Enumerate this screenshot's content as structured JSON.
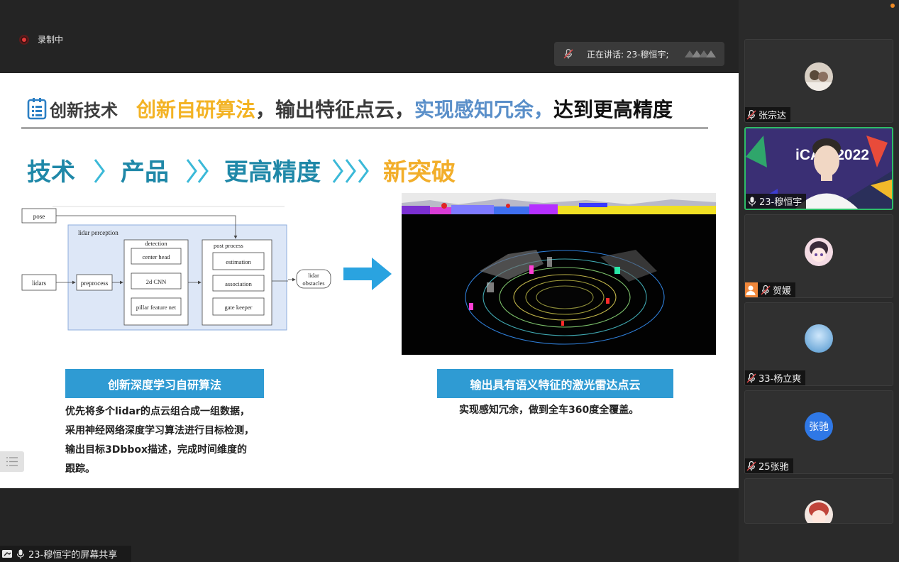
{
  "recording": {
    "label": "录制中"
  },
  "speaking": {
    "text": "正在讲话: 23-穆恒宇;"
  },
  "slide": {
    "title_main": "创新技术",
    "title_parts": [
      "创新自研算法",
      "，输出特征点云，",
      "实现感知冗余，",
      "达到更高精度"
    ],
    "steps": [
      "技术",
      "产品",
      "更高精度",
      "新突破"
    ],
    "diagram": {
      "pose": "pose",
      "lidars": "lidars",
      "group_label": "lidar perception",
      "preprocess": "preprocess",
      "detection_label": "detection",
      "detection_items": [
        "center head",
        "2d CNN",
        "pillar feature net"
      ],
      "post_label": "post process",
      "post_items": [
        "estimation",
        "association",
        "gate keeper"
      ],
      "output_line1": "lidar",
      "output_line2": "obstacles"
    },
    "banner_left": "创新深度学习自研算法",
    "banner_right": "输出具有语义特征的激光雷达点云",
    "left_desc": [
      "优先将多个lidar的点云组合成一组数据，",
      "采用神经网络深度学习算法进行目标检测，",
      "输出目标3Dbbox描述，完成时间维度的",
      "跟踪。"
    ],
    "right_desc": "实现感知冗余，做到全车360度全覆盖。"
  },
  "share_bar": {
    "label": "23-穆恒宇的屏幕共享"
  },
  "participants": [
    {
      "name": "张宗达",
      "mic": "muted",
      "avatar": "photo"
    },
    {
      "name": "23-穆恒宇",
      "mic": "speaking",
      "avatar": "video",
      "video_overlay_text": "iCAN 2022"
    },
    {
      "name": "贺媛",
      "mic": "muted",
      "avatar": "anime",
      "host": true
    },
    {
      "name": "33-杨立爽",
      "mic": "muted",
      "avatar": "sky"
    },
    {
      "name": "25张驰",
      "mic": "muted",
      "avatar": "text",
      "avatar_text": "张驰"
    },
    {
      "name": "",
      "mic": "muted",
      "avatar": "anime2"
    }
  ],
  "colors": {
    "accent_blue": "#2f9bd3",
    "title_yellow": "#f3b324",
    "title_blue": "#5a8fc9",
    "step_blue": "#1f88a8",
    "step_orange": "#f2ae2a",
    "active_border": "#2ebd68"
  }
}
